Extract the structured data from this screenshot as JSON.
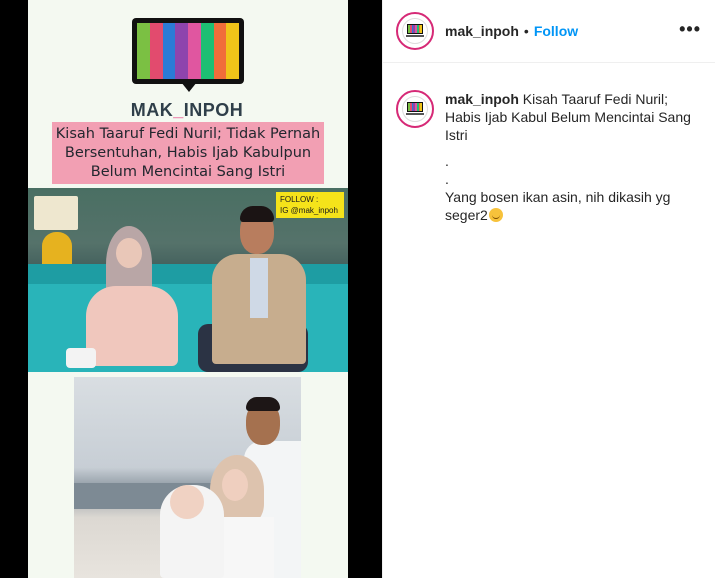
{
  "media": {
    "brand_prefix": "MAK",
    "brand_sep": "_",
    "brand_suffix": "INPOH",
    "headline": "Kisah Taaruf Fedi Nuril; Tidak Pernah Bersentuhan, Habis Ijab Kabulpun Belum Mencintai Sang Istri",
    "follow_badge_line1": "FOLLOW :",
    "follow_badge_line2": "IG @mak_inpoh",
    "tv_colors": [
      "#7bc043",
      "#e24b6e",
      "#2b7bd6",
      "#8e44ad",
      "#e056a0",
      "#1dbf73",
      "#f16d3a",
      "#f0c419"
    ]
  },
  "header": {
    "username": "mak_inpoh",
    "separator": "•",
    "follow_label": "Follow",
    "more_icon": "•••"
  },
  "caption": {
    "username": "mak_inpoh",
    "text_line1": "Kisah Taaruf Fedi Nuril; Habis Ijab Kabul Belum Mencintai Sang Istri",
    "dot1": ".",
    "dot2": ".",
    "text_line2": "Yang bosen ikan asin, nih dikasih yg seger2"
  },
  "colors": {
    "follow_blue": "#0095f6",
    "headline_pink": "#f29fb3"
  }
}
